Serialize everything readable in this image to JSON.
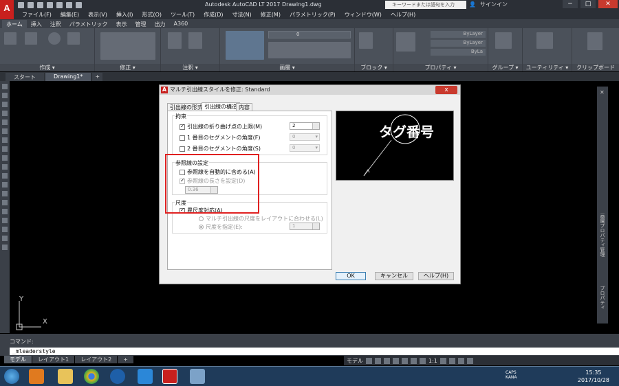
{
  "window": {
    "title": "Autodesk AutoCAD LT 2017    Drawing1.dwg",
    "search_placeholder": "キーワードまたは語句を入力",
    "signin": "サインイン",
    "logo": "A",
    "logo_sub": "LT"
  },
  "menubar": [
    "ファイル(F)",
    "編集(E)",
    "表示(V)",
    "挿入(I)",
    "形式(O)",
    "ツール(T)",
    "作成(D)",
    "寸法(N)",
    "修正(M)",
    "パラメトリック(P)",
    "ウィンドウ(W)",
    "ヘルプ(H)"
  ],
  "ribbon_tabs": [
    "ホーム",
    "挿入",
    "注釈",
    "パラメトリック",
    "表示",
    "管理",
    "出力",
    "A360"
  ],
  "ribbon_panels": [
    "作成 ▾",
    "修正 ▾",
    "注釈 ▾",
    "画層 ▾",
    "ブロック ▾",
    "プロパティ ▾",
    "グループ ▾",
    "ユーティリティ ▾",
    "クリップボード"
  ],
  "ribbon_props": {
    "bylayer1": "ByLayer",
    "bylayer2": "ByLayer",
    "bylayer3": "ByLa",
    "layer_value": "0"
  },
  "doc_tabs": [
    "スタート",
    "Drawing1*",
    "+"
  ],
  "dialog": {
    "title": "マルチ引出線スタイルを修正: Standard",
    "close": "x",
    "tabs": [
      "引出線の形式",
      "引出線の構造",
      "内容"
    ],
    "group_constraints": {
      "title": "拘束",
      "max_points": {
        "label": "引出線の折り曲げ点の上限(M)",
        "value": "2"
      },
      "first_angle": {
        "label": "1 番目のセグメントの角度(F)",
        "value": "0"
      },
      "second_angle": {
        "label": "2 番目のセグメントの角度(S)",
        "value": "0"
      }
    },
    "group_landing": {
      "title": "参照線の設定",
      "auto_include": {
        "label": "参照線を自動的に含める(A)"
      },
      "set_distance": {
        "label": "参照線の長さを設定(D)",
        "value": "0.36"
      }
    },
    "group_scale": {
      "title": "尺度",
      "annotative": {
        "label": "異尺度対応(A)"
      },
      "scale_to_layout": {
        "label": "マルチ引出線の尺度をレイアウトに合わせる(L)"
      },
      "specify_scale": {
        "label": "尺度を指定(E):",
        "value": "1"
      }
    },
    "preview_text": "タグ番号",
    "buttons": {
      "ok": "OK",
      "cancel": "キャンセル",
      "help": "ヘルプ(H)"
    }
  },
  "ucs": {
    "x": "X",
    "y": "Y"
  },
  "right_palette": {
    "label1": "画層プロパティ管理",
    "label2": "プロパティ"
  },
  "command": {
    "label": "コマンド:",
    "line": "_mleaderstyle"
  },
  "layout_tabs": [
    "モデル",
    "レイアウト1",
    "レイアウト2",
    "+"
  ],
  "status": {
    "model": "モデル",
    "scale": "1:1"
  },
  "taskbar": {
    "time": "15:35",
    "date": "2017/10/28",
    "caps": "CAPS",
    "kana": "KANA"
  }
}
